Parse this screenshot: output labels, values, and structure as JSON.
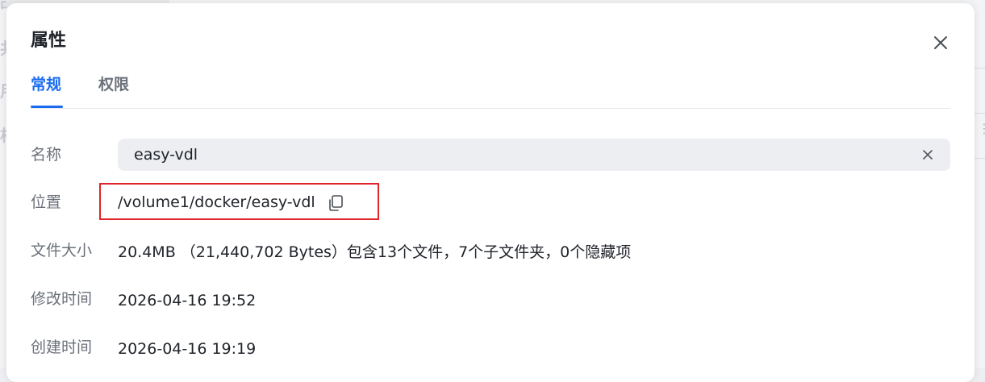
{
  "background": {
    "partial_chars": [
      "共",
      "用",
      "相",
      "中"
    ]
  },
  "dialog": {
    "title": "属性",
    "close_icon": "close-icon"
  },
  "tabs": [
    {
      "label": "常规",
      "active": true
    },
    {
      "label": "权限",
      "active": false
    }
  ],
  "fields": {
    "name": {
      "label": "名称",
      "value": "easy-vdl",
      "clear_icon": "clear-icon"
    },
    "location": {
      "label": "位置",
      "value": "/volume1/docker/easy-vdl",
      "copy_icon": "copy-icon"
    },
    "size": {
      "label": "文件大小",
      "value": "20.4MB （21,440,702 Bytes）包含13个文件，7个子文件夹，0个隐藏项"
    },
    "modified": {
      "label": "修改时间",
      "value": "2026-04-16 19:52"
    },
    "created": {
      "label": "创建时间",
      "value": "2026-04-16 19:19"
    }
  },
  "colors": {
    "accent": "#1a6bf0",
    "highlight_border": "#e0242b",
    "input_bg": "#eceef2"
  }
}
